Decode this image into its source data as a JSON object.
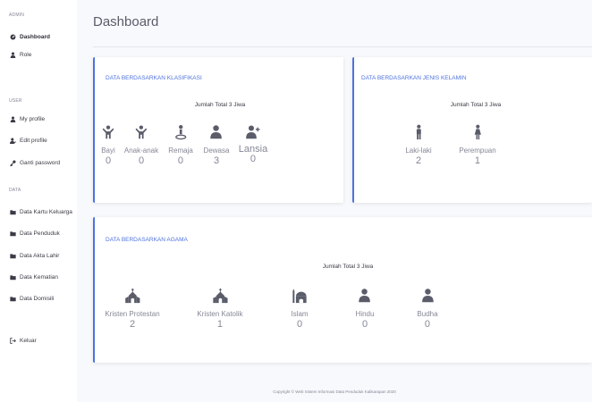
{
  "sidebar": {
    "heading_admin": "ADMIN",
    "heading_user": "USER",
    "heading_data": "DATA",
    "items": [
      {
        "label": "Dashboard",
        "icon": "dashboard-icon"
      },
      {
        "label": "Role",
        "icon": "user-tie-icon"
      },
      {
        "label": "My profile",
        "icon": "user-icon"
      },
      {
        "label": "Edit profile",
        "icon": "user-edit-icon"
      },
      {
        "label": "Ganti password",
        "icon": "key-icon"
      },
      {
        "label": "Data Kartu Keluarga",
        "icon": "folder-icon"
      },
      {
        "label": "Data Penduduk",
        "icon": "folder-icon"
      },
      {
        "label": "Data Akta Lahir",
        "icon": "folder-icon"
      },
      {
        "label": "Data Kematian",
        "icon": "folder-icon"
      },
      {
        "label": "Data Domisili",
        "icon": "folder-icon"
      },
      {
        "label": "Keluar",
        "icon": "sign-out-icon"
      }
    ]
  },
  "header": {
    "title": "Dashboard"
  },
  "cards": {
    "klasifikasi": {
      "title": "DATA BERDASARKAN KLASIFIKASI",
      "total": "Jumlah Total 3 Jiwa",
      "stats": [
        {
          "label": "Bayi",
          "value": "0",
          "icon": "baby-icon"
        },
        {
          "label": "Anak-anak",
          "value": "0",
          "icon": "child-icon"
        },
        {
          "label": "Remaja",
          "value": "0",
          "icon": "teen-icon"
        },
        {
          "label": "Dewasa",
          "value": "3",
          "icon": "adult-icon"
        },
        {
          "label": "Lansia",
          "value": "0",
          "icon": "elderly-icon"
        }
      ]
    },
    "jenis_kelamin": {
      "title": "DATA BERDASARKAN JENIS KELAMIN",
      "total": "Jumlah Total 3 Jiwa",
      "stats": [
        {
          "label": "Laki-laki",
          "value": "2",
          "icon": "male-icon"
        },
        {
          "label": "Perempuan",
          "value": "1",
          "icon": "female-icon"
        }
      ]
    },
    "agama": {
      "title": "DATA BERDASARKAN AGAMA",
      "total": "Jumlah Total 3 Jiwa",
      "stats": [
        {
          "label": "Kristen Protestan",
          "value": "2",
          "icon": "church-icon"
        },
        {
          "label": "Kristen Katolik",
          "value": "1",
          "icon": "church-icon"
        },
        {
          "label": "Islam",
          "value": "0",
          "icon": "mosque-icon"
        },
        {
          "label": "Hindu",
          "value": "0",
          "icon": "user-icon"
        },
        {
          "label": "Budha",
          "value": "0",
          "icon": "user-icon"
        }
      ]
    }
  },
  "footer": {
    "text": "Copyright © Web Sistem Informasi Data Penduduk Kalikarapan 2020"
  },
  "colors": {
    "accent": "#4e73df",
    "icon": "#5a5c69",
    "text_muted": "#858796"
  }
}
